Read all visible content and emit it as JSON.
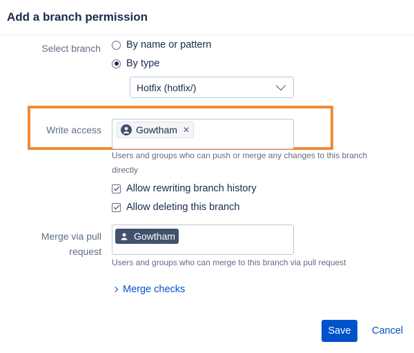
{
  "dialog": {
    "title": "Add a branch permission"
  },
  "select_branch": {
    "label": "Select branch",
    "options": [
      {
        "label": "By name or pattern",
        "selected": false
      },
      {
        "label": "By type",
        "selected": true
      }
    ],
    "type_select": {
      "value": "Hotfix (hotfix/)"
    }
  },
  "write_access": {
    "label": "Write access",
    "users": [
      "Gowtham"
    ],
    "help": "Users and groups who can push or merge any changes to this branch directly",
    "help_line1": "Users and groups who can push or merge any changes to this branch",
    "help_line2": "directly",
    "checkboxes": [
      {
        "label": "Allow rewriting branch history",
        "checked": true
      },
      {
        "label": "Allow deleting this branch",
        "checked": true
      }
    ]
  },
  "merge_pr": {
    "label_line1": "Merge via pull",
    "label_line2": "request",
    "users": [
      "Gowtham"
    ],
    "help": "Users and groups who can merge to this branch via pull request"
  },
  "merge_checks": {
    "label": "Merge checks"
  },
  "actions": {
    "save_label": "Save",
    "cancel_label": "Cancel"
  },
  "colors": {
    "primary": "#0052cc",
    "highlight": "#f08a37",
    "tag_dark": "#42526e"
  },
  "icons": {
    "user_avatar": "user-icon",
    "remove": "x-icon",
    "dropdown": "chevron-down-icon",
    "expand": "chevron-right-icon"
  }
}
